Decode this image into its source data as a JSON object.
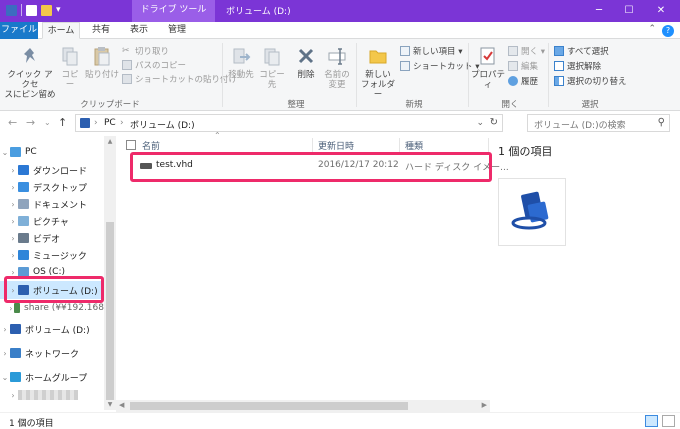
{
  "window": {
    "title": "ボリューム (D:)",
    "contextual_tab": "ドライブ ツール",
    "controls": {
      "minimize": "─",
      "maximize": "☐",
      "close": "✕"
    }
  },
  "quick_access": {
    "dropdown": "▾"
  },
  "tabs": [
    {
      "label": "ファイル"
    },
    {
      "label": "ホーム"
    },
    {
      "label": "共有"
    },
    {
      "label": "表示"
    },
    {
      "label": "管理"
    }
  ],
  "ribbon": {
    "clipboard": {
      "label": "クリップボード",
      "pin_label_1": "クイック アクセ",
      "pin_label_2": "スにピン留め",
      "copy": "コピー",
      "paste": "貼り付け",
      "cut": "切り取り",
      "copy_path": "パスのコピー",
      "paste_shortcut": "ショートカットの貼り付け"
    },
    "organize": {
      "label": "整理",
      "move_to": "移動先",
      "copy_to": "コピー先",
      "delete": "削除",
      "rename_1": "名前の",
      "rename_2": "変更"
    },
    "new": {
      "label": "新規",
      "new_folder_1": "新しい",
      "new_folder_2": "フォルダー",
      "new_item": "新しい項目 ▾",
      "shortcut": "ショートカット ▾"
    },
    "open": {
      "label": "開く",
      "properties": "プロパティ",
      "open": "開く ▾",
      "edit": "編集",
      "history": "履歴"
    },
    "select": {
      "label": "選択",
      "select_all": "すべて選択",
      "select_none": "選択解除",
      "invert": "選択の切り替え"
    }
  },
  "address": {
    "pc": "PC",
    "sep": "›",
    "volume": "ボリューム (D:)",
    "search_placeholder": "ボリューム (D:)の検索"
  },
  "nav": [
    {
      "label": "PC",
      "color": "#4a9de0"
    },
    {
      "label": "ダウンロード",
      "color": "#2b78d4"
    },
    {
      "label": "デスクトップ",
      "color": "#3a8fe0"
    },
    {
      "label": "ドキュメント",
      "color": "#8fa4bd"
    },
    {
      "label": "ピクチャ",
      "color": "#7fb0d8"
    },
    {
      "label": "ビデオ",
      "color": "#6a7b8c"
    },
    {
      "label": "ミュージック",
      "color": "#2f85d9"
    },
    {
      "label": "OS (C:)",
      "color": "#5b9bd5"
    },
    {
      "label": "ボリューム (D:)",
      "color": "#2c5fb0"
    },
    {
      "label": "share (¥¥192.168",
      "color": "#4a8a4a"
    },
    {
      "label": "ボリューム (D:)",
      "color": "#2c5fb0"
    },
    {
      "label": "ネットワーク",
      "color": "#3a7fc8"
    },
    {
      "label": "ホームグループ",
      "color": "#2a9ad8"
    }
  ],
  "columns": {
    "name": "名前",
    "date": "更新日時",
    "type": "種類"
  },
  "files": [
    {
      "name": "test.vhd",
      "date": "2016/12/17 20:12",
      "type": "ハード ディスク イメー..."
    }
  ],
  "details": {
    "count": "1 個の項目"
  },
  "status": {
    "count": "1 個の項目"
  },
  "colors": {
    "titlebar": "#7b35d6",
    "file_tab": "#1979ca",
    "highlight": "#ee2a6a",
    "selected": "#cce8ff"
  }
}
